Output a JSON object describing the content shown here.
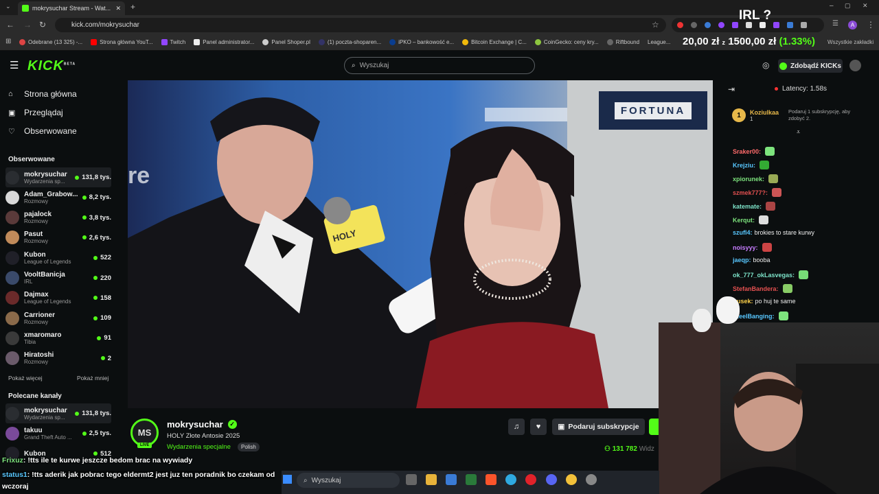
{
  "browser": {
    "tab_title": "mokrysuchar Stream - Wat...",
    "url": "kick.com/mokrysuchar",
    "bookmarks": [
      "Odebrane (13 325) -...",
      "Strona główna YouT...",
      "Twitch",
      "Panel administrator...",
      "Panel Shoper.pl",
      "(1) poczta-shoparen...",
      "iPKO – bankowość e...",
      "Bitcoin Exchange | C...",
      "CoinGecko: ceny kry...",
      "Riftbound",
      "League..."
    ],
    "all_bookmarks": "Wszystkie zakładki"
  },
  "overlay": {
    "irl": "IRL ?",
    "price_left": "20,00 zł",
    "price_sep": "z",
    "price_right": "1500,00 zł",
    "price_pct": "(1.33%)"
  },
  "kick": {
    "logo": "KICK",
    "beta": "BETA",
    "search_placeholder": "Wyszukaj",
    "get_kicks": "Zdobądź KICKs"
  },
  "sidebar": {
    "nav": [
      "Strona główna",
      "Przeglądaj",
      "Obserwowane"
    ],
    "followed_title": "Obserwowane",
    "followed": [
      {
        "name": "mokrysuchar",
        "cat": "Wydarzenia sp...",
        "viewers": "131,8 tys.",
        "color": "#2a2d31"
      },
      {
        "name": "Adam_Grabow...",
        "cat": "Rozmowy",
        "viewers": "8,2 tys.",
        "color": "#d8d8d8"
      },
      {
        "name": "pajalock",
        "cat": "Rozmowy",
        "viewers": "3,8 tys.",
        "color": "#5a3a3a"
      },
      {
        "name": "Pasut",
        "cat": "Rozmowy",
        "viewers": "2,6 tys.",
        "color": "#c08a5a"
      },
      {
        "name": "Kubon",
        "cat": "League of Legends",
        "viewers": "522",
        "color": "#202028"
      },
      {
        "name": "VooltBanicja",
        "cat": "IRL",
        "viewers": "220",
        "color": "#3a4a6a"
      },
      {
        "name": "Dajmax",
        "cat": "League of Legends",
        "viewers": "158",
        "color": "#6a2a2a"
      },
      {
        "name": "Carrioner",
        "cat": "Rozmowy",
        "viewers": "109",
        "color": "#8a6a4a"
      },
      {
        "name": "xmaromaro",
        "cat": "Tibia",
        "viewers": "91",
        "color": "#3a3a3a"
      },
      {
        "name": "Hiratoshi",
        "cat": "Rozmowy",
        "viewers": "2",
        "color": "#6a5a6a"
      }
    ],
    "show_more": "Pokaż więcej",
    "show_less": "Pokaż mniej",
    "recommended_title": "Polecane kanały",
    "recommended": [
      {
        "name": "mokrysuchar",
        "cat": "Wydarzenia sp...",
        "viewers": "131,8 tys.",
        "color": "#2a2d31"
      },
      {
        "name": "takuu",
        "cat": "Grand Theft Auto ...",
        "viewers": "2,5 tys.",
        "color": "#7a4a9a"
      },
      {
        "name": "Kubon",
        "cat": "",
        "viewers": "512",
        "color": "#202028"
      }
    ]
  },
  "video": {
    "sponsor": "FORTUNA",
    "mic_label": "HOLY"
  },
  "stream": {
    "avatar": "MS",
    "live": "LIVE",
    "name": "mokrysuchar",
    "title": "HOLY Złote Antosie 2025",
    "category": "Wydarzenia specjalne",
    "lang": "Polish",
    "subscribe": "Podaruj subskrypcje",
    "viewers": "131 782",
    "viewers_suffix": "Widz"
  },
  "chat": {
    "latency": "Latency: 1.58s",
    "pinned_user": "Koziulkaa",
    "pinned_rank": "1",
    "pinned_count": "1",
    "gift_text": "Podaruj 1 subskrypcję, aby zdobyć 2.",
    "messages": [
      {
        "user": "Sraker00:",
        "text": "",
        "color": "#ff6b6b"
      },
      {
        "user": "Krejziu:",
        "text": "",
        "color": "#58c7ff"
      },
      {
        "user": "xpiorunek:",
        "text": "",
        "color": "#7de37d"
      },
      {
        "user": "szmek777?:",
        "text": "",
        "color": "#e35050"
      },
      {
        "user": "katemate:",
        "text": "",
        "color": "#7de3c9"
      },
      {
        "user": "Kerqut:",
        "text": "",
        "color": "#7de37d"
      },
      {
        "user": "szufl4:",
        "text": "brokies to stare kurwy",
        "color": "#58c7ff"
      },
      {
        "user": "noisyyy:",
        "text": "",
        "color": "#c77dff"
      },
      {
        "user": "jaeqp:",
        "text": "booba",
        "color": "#58c7ff"
      },
      {
        "user": "ok_777_okLasvegas:",
        "text": "",
        "color": "#7de3c9"
      },
      {
        "user": "StefanBandera:",
        "text": "",
        "color": "#e35050"
      },
      {
        "user": "irusek:",
        "text": "po huj te same",
        "color": "#ffd24a"
      },
      {
        "user": "SteelBanging:",
        "text": "",
        "color": "#58c7ff"
      }
    ]
  },
  "bottom_chat": [
    {
      "user": "Frixuz",
      "text": ": !tts ile te kurwe jeszcze bedom brac na wywiady",
      "color": "#7de37d"
    },
    {
      "user": "status1",
      "text": ": !tts aderik jak pobrac tego eldermt2 jest juz ten poradnik bo czekam od",
      "color": "#58c7ff"
    },
    {
      "user": "",
      "text": "wczoraj",
      "color": "#ffffff"
    }
  ],
  "taskbar": {
    "search": "Wyszukaj"
  }
}
